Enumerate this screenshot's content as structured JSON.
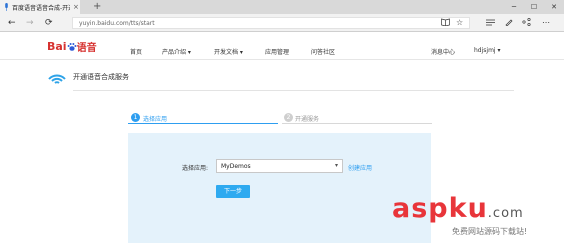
{
  "browser": {
    "tab_title": "百度语音语音合成-开通",
    "tab_close": "×",
    "new_tab": "+",
    "window_controls": [
      "─",
      "☐",
      "✕"
    ],
    "back": "←",
    "forward": "→",
    "refresh": "⟳",
    "url": "yuyin.baidu.com/tts/start",
    "toolbar_icons": [
      "reading-view-icon",
      "favorite-star-icon",
      "hub-icon",
      "notes-icon",
      "share-icon",
      "more-icon"
    ]
  },
  "header": {
    "logo_bai": "Bai",
    "logo_paw": "du",
    "logo_yy": "语音",
    "nav": [
      "首页",
      "产品介绍 ▾",
      "开发文档 ▾",
      "应用管理",
      "问答社区"
    ],
    "message_center": "消息中心",
    "user": "hdjsjmj ▾"
  },
  "service": {
    "title": "开通语音合成服务"
  },
  "steps": [
    {
      "num": "1",
      "label": "选择应用"
    },
    {
      "num": "2",
      "label": "开通服务"
    }
  ],
  "form": {
    "select_label": "选择应用:",
    "selected_app": "MyDemos",
    "create_link": "创建应用",
    "next_button": "下一步"
  },
  "watermark": {
    "main": "aspku",
    "dotcom": ".com",
    "sub": "免费网站源码下载站!"
  },
  "colors": {
    "accent": "#2e9ef0",
    "brand_red": "#d63230",
    "panel_bg": "#e4f2fb"
  }
}
